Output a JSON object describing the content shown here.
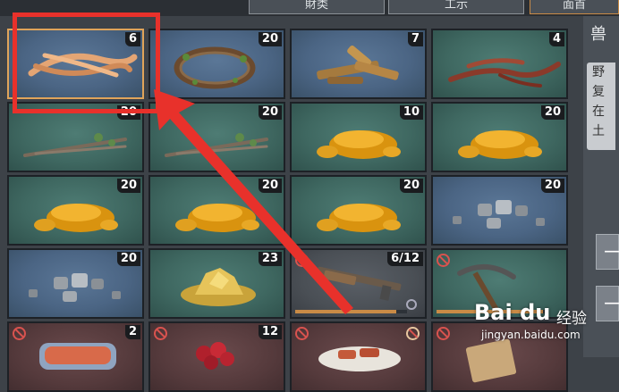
{
  "tabs": [
    {
      "label": "財类"
    },
    {
      "label": "工示"
    },
    {
      "label": "面首"
    }
  ],
  "inventory": [
    {
      "item": "leather-strips",
      "count": "6",
      "bg": "blue",
      "selected": true
    },
    {
      "item": "vine-wreath",
      "count": "20",
      "bg": "blue"
    },
    {
      "item": "wood-logs",
      "count": "7",
      "bg": "blue"
    },
    {
      "item": "red-roots",
      "count": "4",
      "bg": "green"
    },
    {
      "item": "branches",
      "count": "20",
      "bg": "green"
    },
    {
      "item": "branches",
      "count": "20",
      "bg": "green"
    },
    {
      "item": "resin",
      "count": "10",
      "bg": "green"
    },
    {
      "item": "resin",
      "count": "20",
      "bg": "green"
    },
    {
      "item": "resin",
      "count": "20",
      "bg": "green"
    },
    {
      "item": "resin",
      "count": "20",
      "bg": "green"
    },
    {
      "item": "resin",
      "count": "20",
      "bg": "green"
    },
    {
      "item": "stones",
      "count": "20",
      "bg": "blue"
    },
    {
      "item": "stones",
      "count": "20",
      "bg": "blue"
    },
    {
      "item": "gold-ore",
      "count": "23",
      "bg": "green"
    },
    {
      "item": "rifle",
      "count": "6/12",
      "bg": "gray",
      "banned": true,
      "durability": 0.9
    },
    {
      "item": "pickaxe",
      "count": "",
      "bg": "green",
      "banned": true,
      "durability": 0.95
    },
    {
      "item": "fish-can",
      "count": "2",
      "bg": "red",
      "banned": true
    },
    {
      "item": "berries",
      "count": "12",
      "bg": "red",
      "banned": true
    },
    {
      "item": "meat-dish",
      "count": "",
      "bg": "red",
      "banned": true
    },
    {
      "item": "scroll",
      "count": "",
      "bg": "red",
      "banned": true
    }
  ],
  "sidebar": {
    "title": "兽",
    "desc": [
      "野",
      "复",
      "在",
      "土"
    ],
    "buttons": [
      "—",
      "—"
    ]
  },
  "colors": {
    "highlight": "#e8312b",
    "count_bg": "#1a1c1f",
    "durability": "#c98b46",
    "ban": "#d9534f"
  },
  "watermark": {
    "brand": "Bai du",
    "cn": "经验",
    "url": "jingyan.baidu.com"
  }
}
